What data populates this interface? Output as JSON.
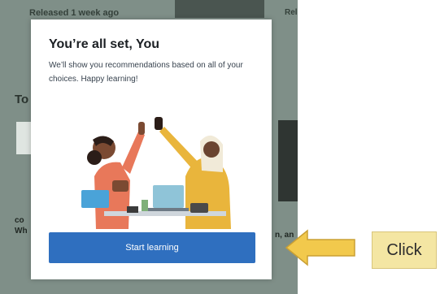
{
  "backdrop": {
    "top_label": "Released 1 week ago",
    "top_right": "Rel",
    "section_label": "To",
    "bottom_left_1": "co",
    "bottom_left_2": "Wh",
    "bottom_right": "n, an"
  },
  "dialog": {
    "title": "You’re all set, You",
    "subtitle": "We’ll show you recommendations based on all of your choices. Happy learning!",
    "cta_label": "Start learning"
  },
  "annotation": {
    "click_label": "Click"
  },
  "colors": {
    "button": "#2f6fbf",
    "arrow": "#f2c94c",
    "click_box": "#f4e6a3"
  }
}
